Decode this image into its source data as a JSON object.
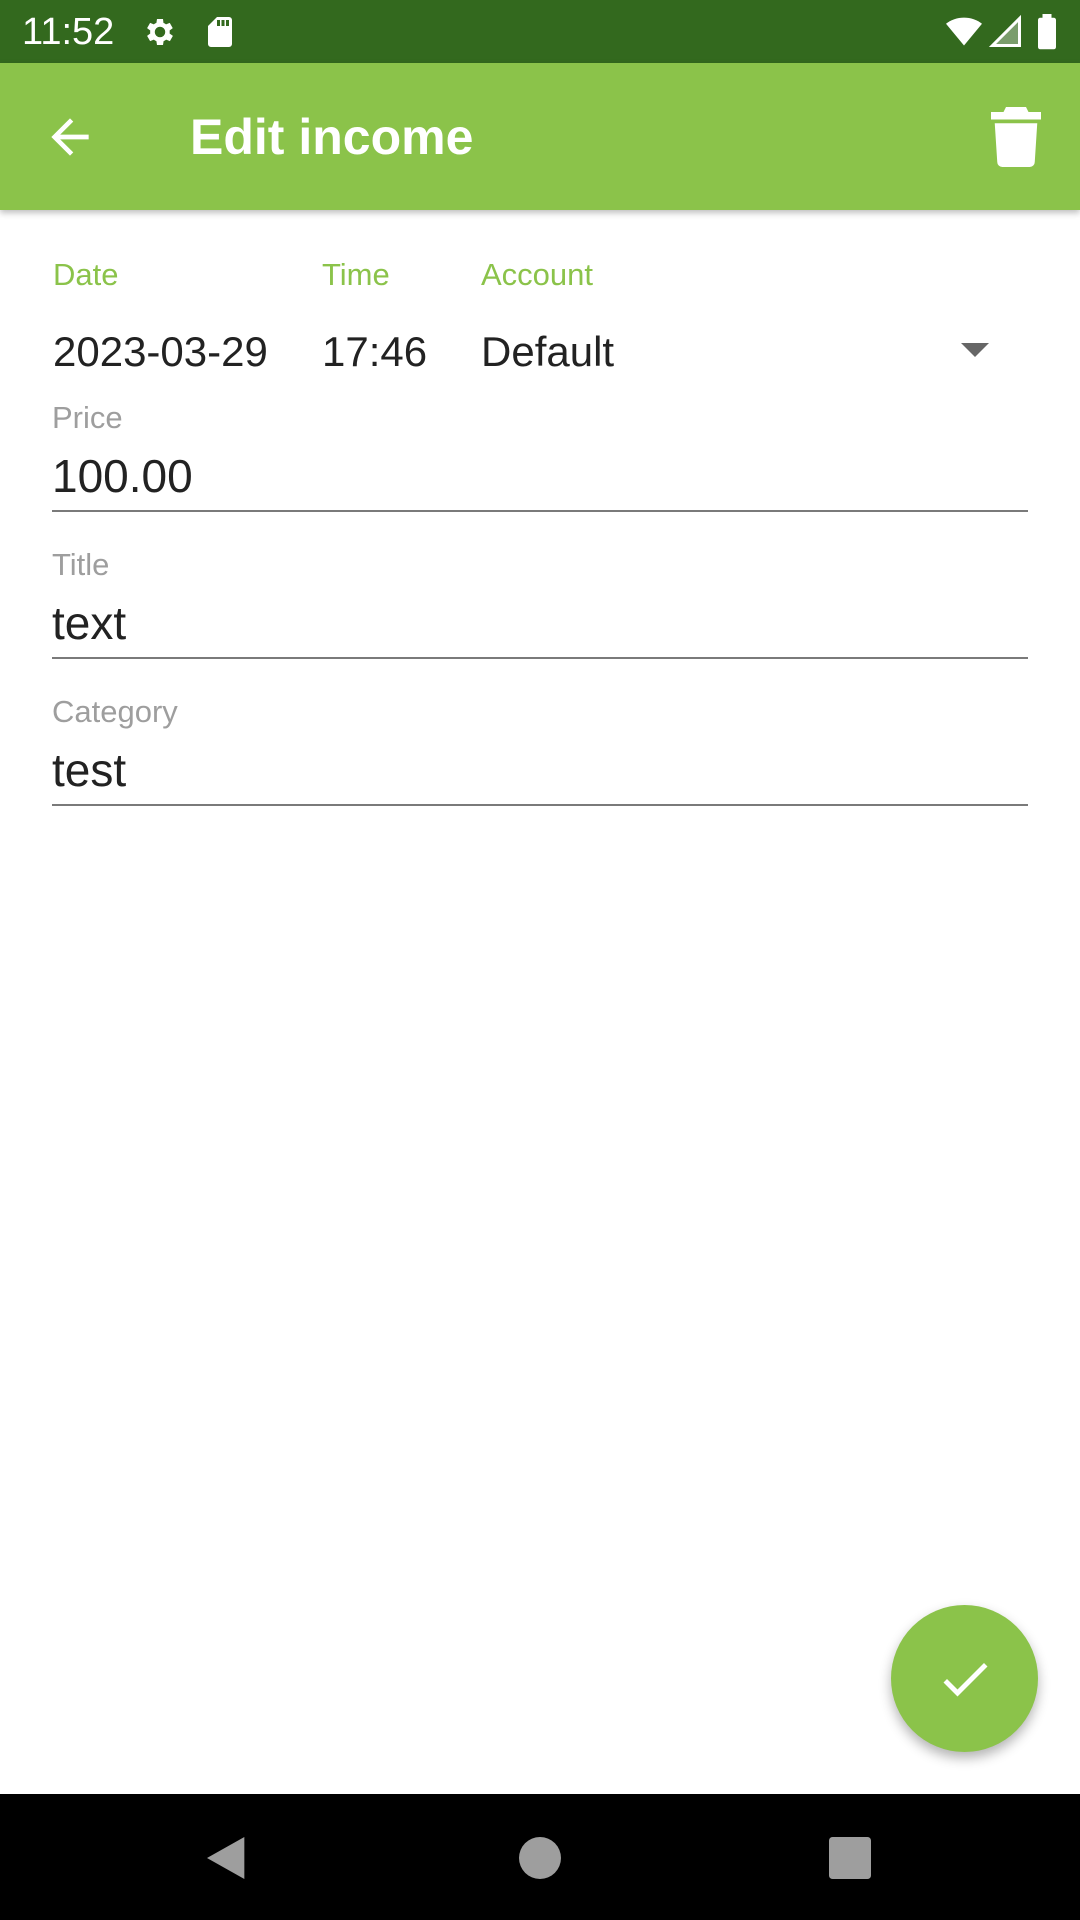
{
  "status_bar": {
    "time": "11:52",
    "left_icons": [
      "gear-icon",
      "sd-card-icon"
    ],
    "right_icons": [
      "wifi-icon",
      "signal-icon",
      "battery-icon"
    ]
  },
  "app_bar": {
    "title": "Edit income",
    "back_icon": "arrow-back-icon",
    "delete_icon": "trash-icon",
    "color": "#8bc34a"
  },
  "form": {
    "date": {
      "label": "Date",
      "value": "2023-03-29"
    },
    "time": {
      "label": "Time",
      "value": "17:46"
    },
    "account": {
      "label": "Account",
      "value": "Default"
    },
    "price": {
      "label": "Price",
      "value": "100.00"
    },
    "title": {
      "label": "Title",
      "value": "text"
    },
    "category": {
      "label": "Category",
      "value": "test"
    }
  },
  "fab": {
    "icon": "check-icon"
  },
  "nav_bar": {
    "icons": [
      "back-triangle-icon",
      "home-circle-icon",
      "recents-square-icon"
    ]
  },
  "colors": {
    "accent": "#8bc34a",
    "status_bar": "#33691e",
    "label": "#9e9e9e"
  }
}
